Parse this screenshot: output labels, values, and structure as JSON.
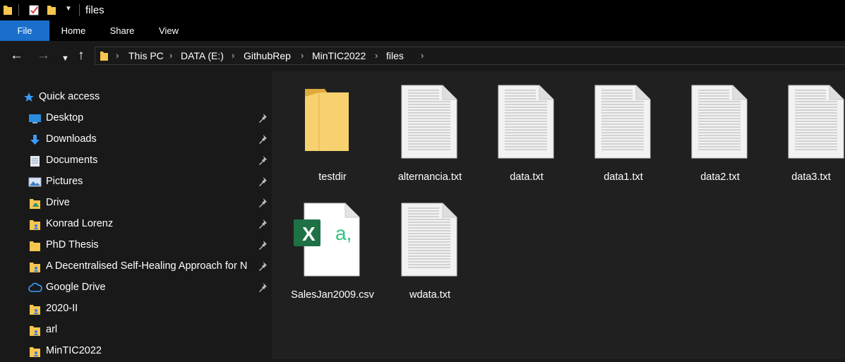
{
  "window": {
    "title": "files"
  },
  "ribbon": {
    "tabs": [
      "File",
      "Home",
      "Share",
      "View"
    ]
  },
  "address": {
    "crumbs": [
      "This PC",
      "DATA (E:)",
      "GithubRep",
      "MinTIC2022",
      "files"
    ]
  },
  "sidebar": {
    "quick_access": "Quick access",
    "items": [
      {
        "label": "Desktop",
        "icon": "desktop-icon",
        "pinned": true
      },
      {
        "label": "Downloads",
        "icon": "download-icon",
        "pinned": true
      },
      {
        "label": "Documents",
        "icon": "documents-icon",
        "pinned": true
      },
      {
        "label": "Pictures",
        "icon": "pictures-icon",
        "pinned": true
      },
      {
        "label": "Drive",
        "icon": "drive-folder-icon",
        "pinned": true
      },
      {
        "label": "Konrad Lorenz",
        "icon": "shared-folder-icon",
        "pinned": true
      },
      {
        "label": "PhD Thesis",
        "icon": "folder-icon",
        "pinned": true
      },
      {
        "label": "A Decentralised Self-Healing Approach for N",
        "icon": "shared-folder-icon",
        "pinned": true
      },
      {
        "label": "Google Drive",
        "icon": "cloud-icon",
        "pinned": true
      },
      {
        "label": "2020-II",
        "icon": "shared-folder-icon",
        "pinned": false
      },
      {
        "label": "arl",
        "icon": "shared-folder-icon",
        "pinned": false
      },
      {
        "label": "MinTIC2022",
        "icon": "shared-folder-icon",
        "pinned": false
      }
    ]
  },
  "files": [
    {
      "name": "testdir",
      "type": "folder"
    },
    {
      "name": "alternancia.txt",
      "type": "text"
    },
    {
      "name": "data.txt",
      "type": "text"
    },
    {
      "name": "data1.txt",
      "type": "text"
    },
    {
      "name": "data2.txt",
      "type": "text"
    },
    {
      "name": "data3.txt",
      "type": "text"
    },
    {
      "name": "SalesJan2009.csv",
      "type": "excel-csv",
      "badge": "X",
      "suffix": "a,"
    },
    {
      "name": "wdata.txt",
      "type": "text"
    }
  ],
  "colors": {
    "accent": "#1a6fcc",
    "folder": "#f7c64e",
    "excel": "#1e7145",
    "excel_accent": "#33c481"
  }
}
